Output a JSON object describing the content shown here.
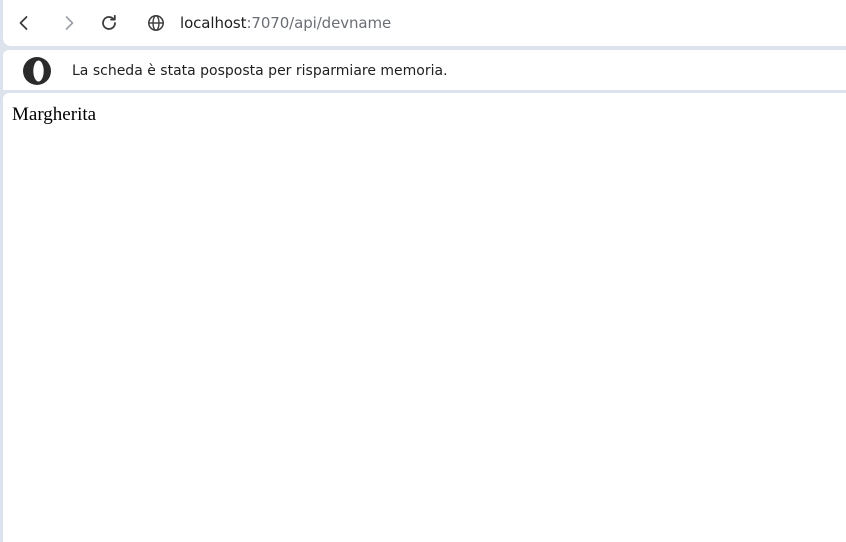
{
  "toolbar": {
    "back_icon": "chevron-left-icon",
    "forward_icon": "chevron-right-icon",
    "reload_icon": "reload-icon",
    "site_info_icon": "globe-icon",
    "url": {
      "host": "localhost",
      "path": ":7070/api/devname"
    }
  },
  "infobar": {
    "logo_icon": "opera-logo-icon",
    "message": "La scheda è stata posposta per risparmiare memoria."
  },
  "page": {
    "body_text": "Margherita"
  },
  "colors": {
    "frame": "#dde3ec",
    "surface": "#ffffff",
    "url_path": "#6b6f75",
    "text": "#1f1f1f"
  }
}
